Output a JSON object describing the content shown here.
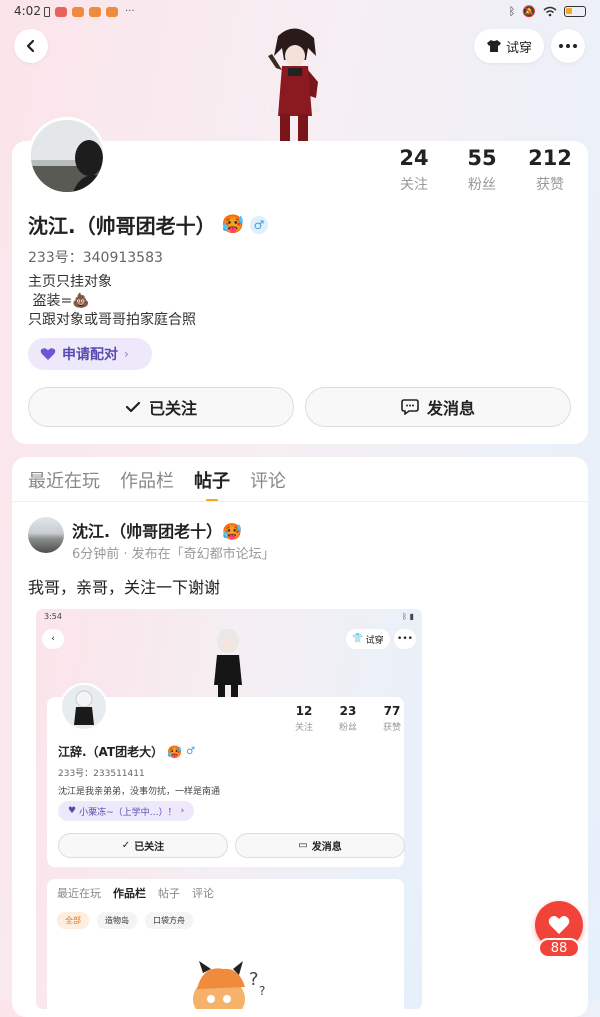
{
  "status_bar": {
    "time": "4:02"
  },
  "header": {
    "tryon_label": "试穿"
  },
  "profile": {
    "name": "沈江.（帅哥团老十）",
    "emoji": "🥵",
    "gender_symbol": "♂",
    "uid": "233号：340913583",
    "bio_lines": [
      "主页只挂对象",
      " 盗装=💩",
      "只跟对象或哥哥拍家庭合照"
    ],
    "pair_label": "申请配对",
    "stats": [
      {
        "value": "24",
        "label": "关注"
      },
      {
        "value": "55",
        "label": "粉丝"
      },
      {
        "value": "212",
        "label": "获赞"
      }
    ],
    "follow_label": "已关注",
    "message_label": "发消息"
  },
  "tabs": [
    {
      "label": "最近在玩",
      "active": false
    },
    {
      "label": "作品栏",
      "active": false
    },
    {
      "label": "帖子",
      "active": true
    },
    {
      "label": "评论",
      "active": false
    }
  ],
  "post": {
    "author": "沈江.（帅哥团老十）🥵",
    "meta": "6分钟前 · 发布在「奇幻都市论坛」",
    "text": "我哥，亲哥，关注一下谢谢",
    "embedded": {
      "time": "3:54",
      "tryon_label": "试穿",
      "name": "江辞.（AT团老大）",
      "emoji": "🥵",
      "gender_symbol": "♂",
      "uid": "233号：233511411",
      "bio": "沈江是我亲弟弟，没事勿扰，一样是南通",
      "pair_label": "小栗冻~（上学中…）！",
      "stats": [
        {
          "value": "12",
          "label": "关注"
        },
        {
          "value": "23",
          "label": "粉丝"
        },
        {
          "value": "77",
          "label": "获赞"
        }
      ],
      "follow_label": "已关注",
      "message_label": "发消息",
      "tabs": [
        {
          "label": "最近在玩",
          "active": false
        },
        {
          "label": "作品栏",
          "active": true
        },
        {
          "label": "帖子",
          "active": false
        },
        {
          "label": "评论",
          "active": false
        }
      ],
      "chips": [
        {
          "label": "全部",
          "active": true
        },
        {
          "label": "造物岛",
          "active": false
        },
        {
          "label": "口袋方舟",
          "active": false
        }
      ]
    }
  },
  "like": {
    "count": "88"
  },
  "colors": {
    "accent": "#f5a623",
    "like": "#f2433b",
    "pair": "#5a4ab0"
  }
}
